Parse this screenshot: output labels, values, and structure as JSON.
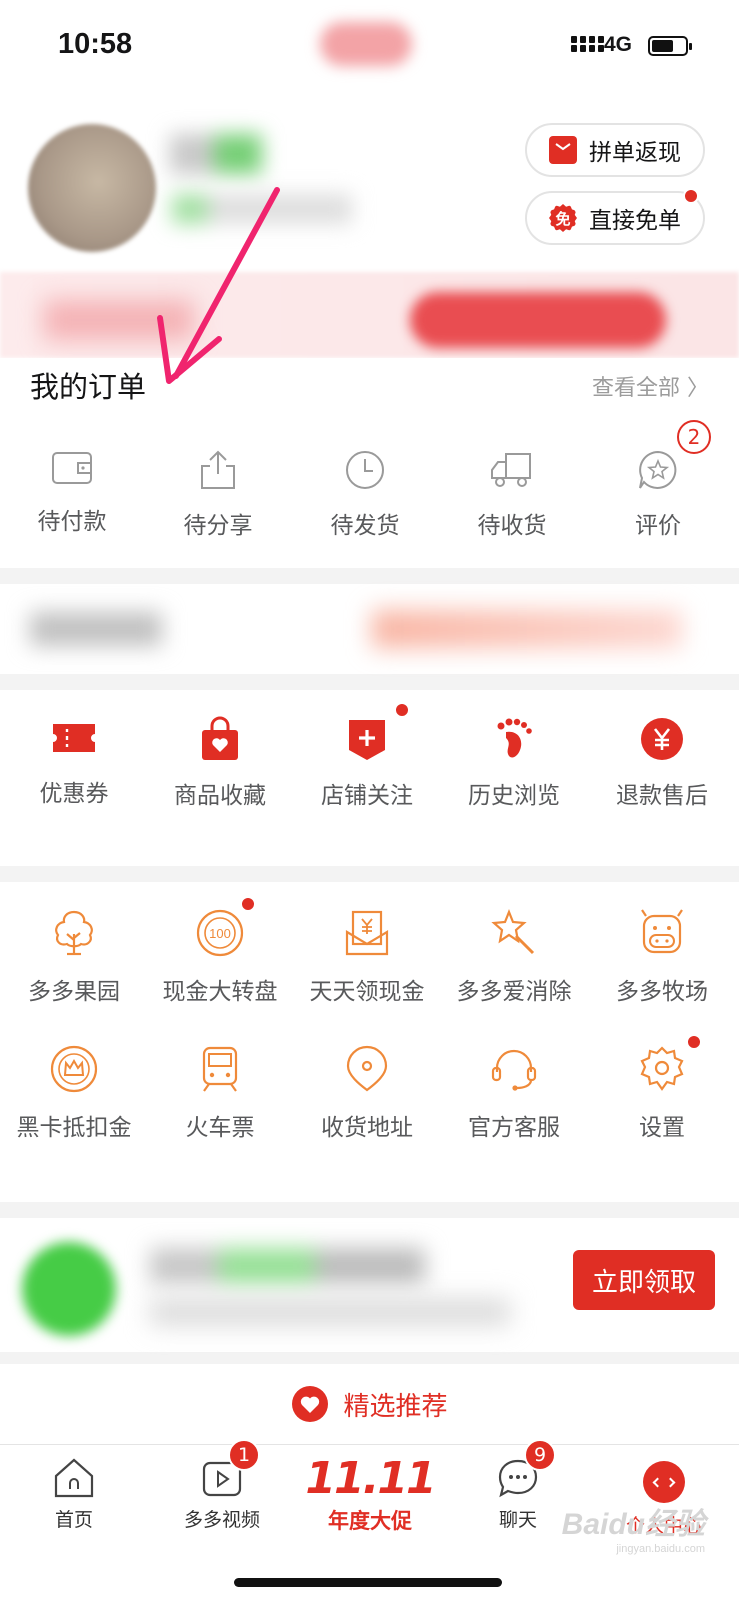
{
  "status_bar": {
    "time": "10:58",
    "network": "4G"
  },
  "profile": {
    "buttons": [
      {
        "label": "拼单返现",
        "icon": "red-packet-icon"
      },
      {
        "label": "直接免单",
        "icon": "free-badge-icon",
        "icon_text": "免"
      }
    ]
  },
  "orders": {
    "title": "我的订单",
    "see_all": "查看全部 〉",
    "items": [
      {
        "label": "待付款",
        "icon": "wallet-icon"
      },
      {
        "label": "待分享",
        "icon": "share-icon"
      },
      {
        "label": "待发货",
        "icon": "clock-icon"
      },
      {
        "label": "待收货",
        "icon": "truck-icon"
      },
      {
        "label": "评价",
        "icon": "review-icon",
        "badge": "2"
      }
    ]
  },
  "tools": {
    "items": [
      {
        "label": "优惠券",
        "icon": "coupon-icon"
      },
      {
        "label": "商品收藏",
        "icon": "favorite-bag-icon"
      },
      {
        "label": "店铺关注",
        "icon": "store-follow-icon"
      },
      {
        "label": "历史浏览",
        "icon": "footprint-icon"
      },
      {
        "label": "退款售后",
        "icon": "refund-icon"
      }
    ]
  },
  "services": {
    "row1": [
      {
        "label": "多多果园",
        "icon": "tree-icon"
      },
      {
        "label": "现金大转盘",
        "icon": "wheel-icon",
        "icon_text": "100"
      },
      {
        "label": "天天领现金",
        "icon": "cash-envelope-icon"
      },
      {
        "label": "多多爱消除",
        "icon": "star-wand-icon"
      },
      {
        "label": "多多牧场",
        "icon": "cow-icon"
      }
    ],
    "row2": [
      {
        "label": "黑卡抵扣金",
        "icon": "crown-coin-icon"
      },
      {
        "label": "火车票",
        "icon": "train-icon"
      },
      {
        "label": "收货地址",
        "icon": "location-icon"
      },
      {
        "label": "官方客服",
        "icon": "headset-icon"
      },
      {
        "label": "设置",
        "icon": "gear-icon"
      }
    ]
  },
  "ad": {
    "button": "立即领取"
  },
  "recommend": {
    "label": "精选推荐"
  },
  "tabbar": {
    "items": [
      {
        "label": "首页",
        "icon": "home-icon"
      },
      {
        "label": "多多视频",
        "icon": "video-icon",
        "badge": "1"
      },
      {
        "label": "年度大促",
        "promo_text": "11.11"
      },
      {
        "label": "聊天",
        "icon": "chat-icon",
        "badge": "9"
      },
      {
        "label": "个人中心",
        "icon": "me-icon"
      }
    ]
  },
  "watermark": {
    "brand": "Baidu经验",
    "url": "jingyan.baidu.com"
  },
  "colors": {
    "brand_red": "#e02e24",
    "icon_orange": "#ef8a3a",
    "annotation_pink": "#f0246e"
  }
}
